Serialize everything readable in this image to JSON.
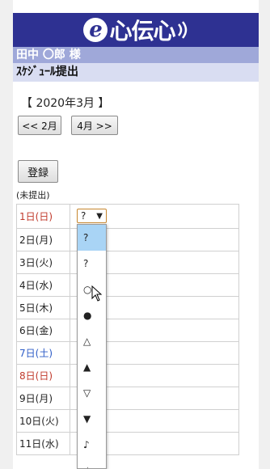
{
  "app": {
    "logo_text": "心伝心",
    "logo_mark": "e",
    "user_name": "田中 〇郎 様",
    "page_title": "ｽｹｼﾞｭｰﾙ提出"
  },
  "month_nav": {
    "current_month": "【 2020年3月 】",
    "prev_label": "<< 2月",
    "next_label": "4月 >>"
  },
  "actions": {
    "register_label": "登録"
  },
  "status_note": "(未提出)",
  "colors": {
    "banner": "#2e3192",
    "user_bar": "#9fa8d9",
    "title_bar": "#d9ddf2",
    "holiday": "#c0392b",
    "saturday": "#2d5cc7",
    "selected_option": "#a9d4f5"
  },
  "days": [
    {
      "label": "1日(日)",
      "kind": "holiday"
    },
    {
      "label": "2日(月)",
      "kind": "weekday"
    },
    {
      "label": "3日(火)",
      "kind": "weekday"
    },
    {
      "label": "4日(水)",
      "kind": "weekday"
    },
    {
      "label": "5日(木)",
      "kind": "weekday"
    },
    {
      "label": "6日(金)",
      "kind": "weekday"
    },
    {
      "label": "7日(土)",
      "kind": "saturday"
    },
    {
      "label": "8日(日)",
      "kind": "holiday"
    },
    {
      "label": "9日(月)",
      "kind": "weekday"
    },
    {
      "label": "10日(火)",
      "kind": "weekday"
    },
    {
      "label": "11日(水)",
      "kind": "weekday"
    }
  ],
  "select": {
    "value": "?",
    "arrow_icon": "triangle-down-icon",
    "options": [
      "?",
      "?",
      "○",
      "●",
      "△",
      "▲",
      "▽",
      "▼",
      "♪",
      "☆"
    ],
    "highlighted_index": 0
  }
}
